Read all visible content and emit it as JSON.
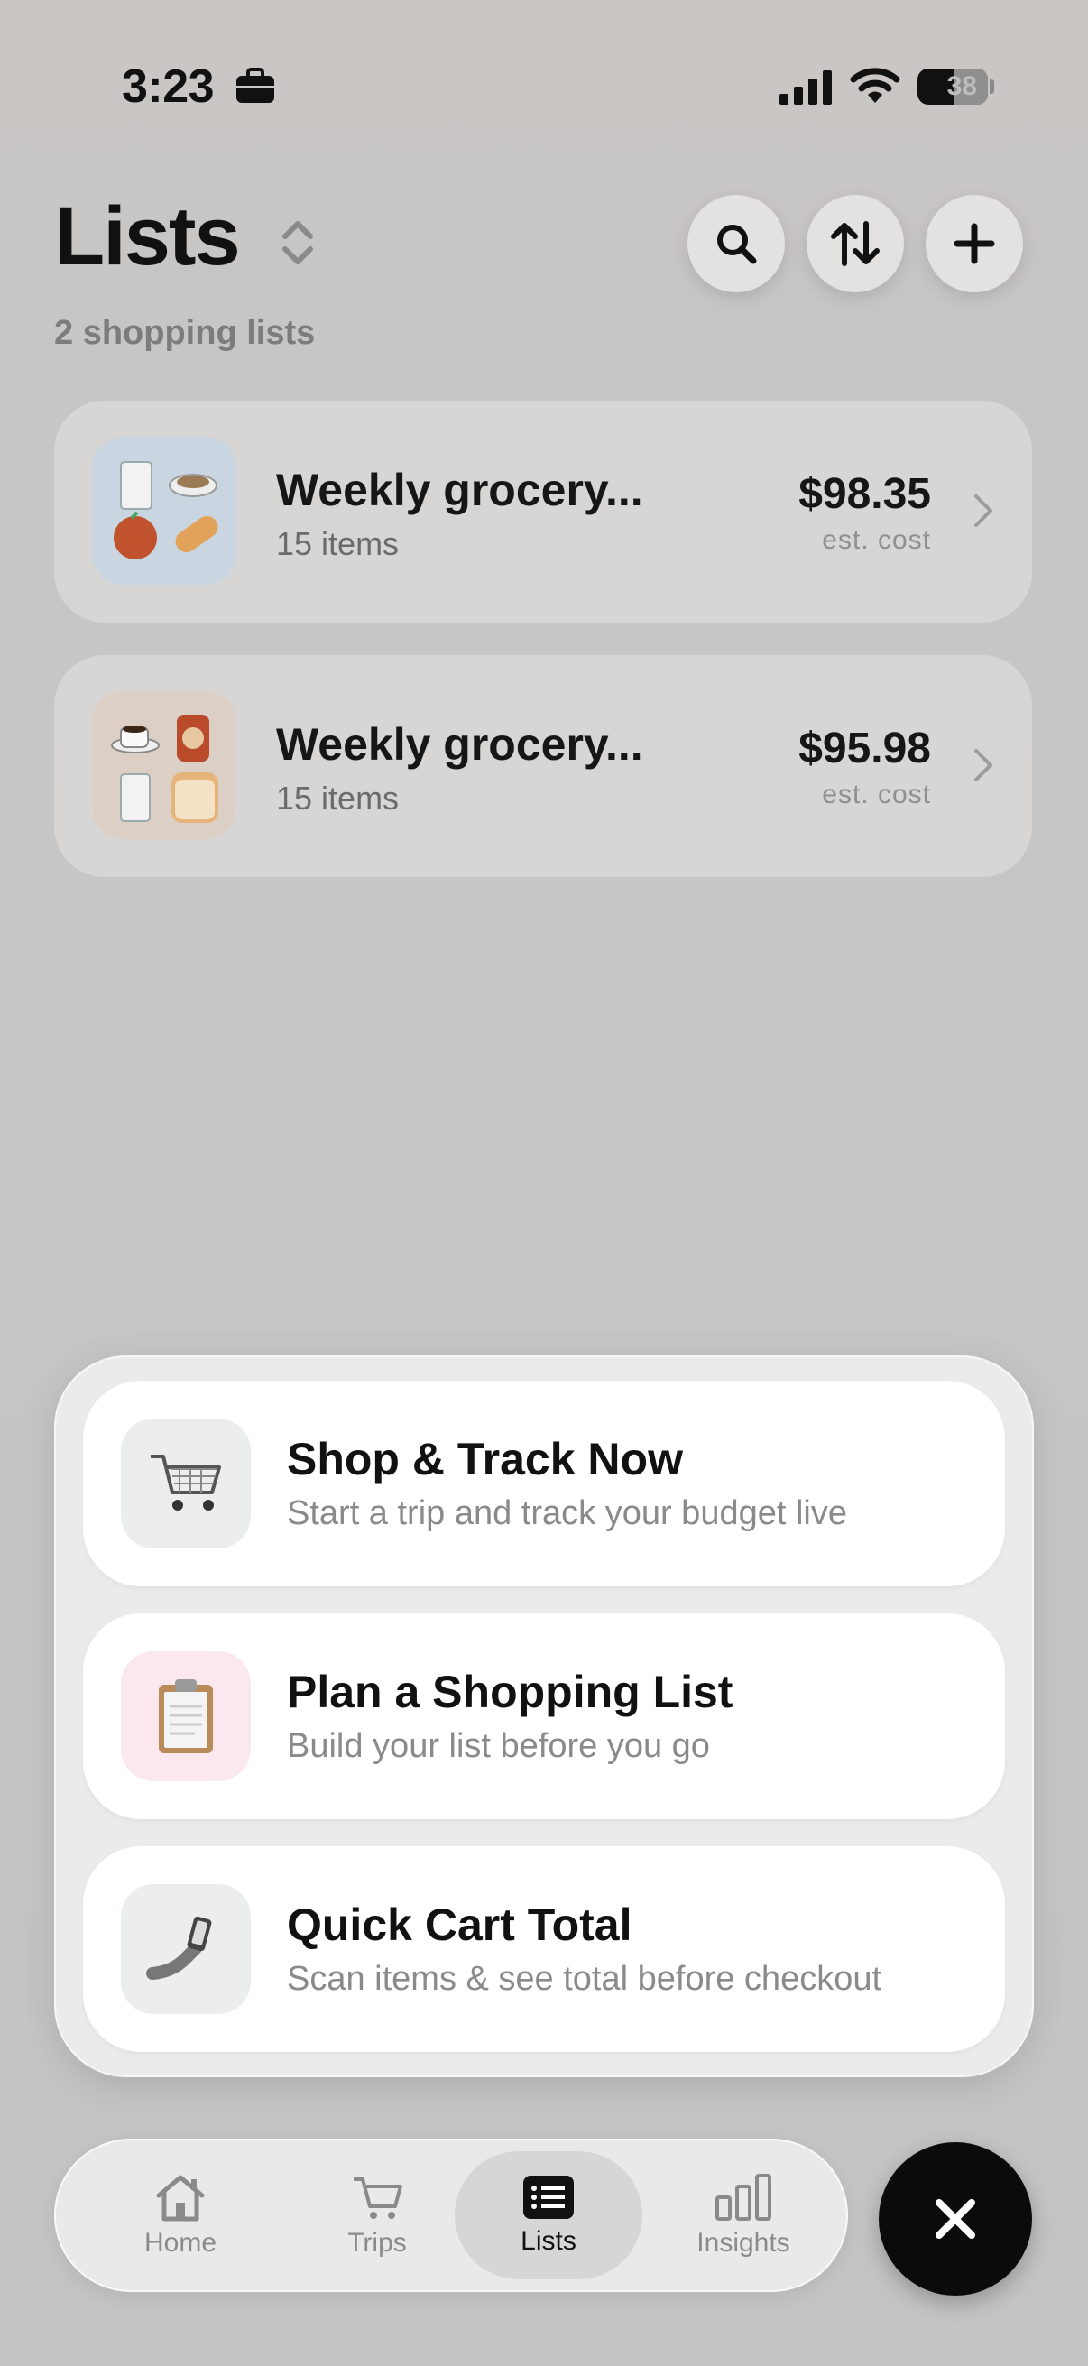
{
  "status_bar": {
    "time": "3:23",
    "battery": "38",
    "icons": [
      "briefcase-icon",
      "cellular-signal-icon",
      "wifi-icon",
      "battery-icon"
    ]
  },
  "header": {
    "title": "Lists",
    "subtitle": "2 shopping lists",
    "buttons": [
      "search-icon",
      "sort-icon",
      "plus-icon"
    ]
  },
  "lists": [
    {
      "title": "Weekly grocery...",
      "count": "15 items",
      "price": "$98.35",
      "price_note": "est. cost",
      "thumb_bg": "#c9d6e2"
    },
    {
      "title": "Weekly grocery...",
      "count": "15 items",
      "price": "$95.98",
      "price_note": "est. cost",
      "thumb_bg": "#dcd0c6"
    }
  ],
  "actions": [
    {
      "title": "Shop & Track Now",
      "subtitle": "Start a trip and track your budget live",
      "icon": "shopping-cart-icon",
      "icon_bg": "#eceeee"
    },
    {
      "title": "Plan a Shopping List",
      "subtitle": "Build your list before you go",
      "icon": "clipboard-icon",
      "icon_bg": "#fbe8ee"
    },
    {
      "title": "Quick Cart Total",
      "subtitle": "Scan items & see total before checkout",
      "icon": "hand-phone-scan-icon",
      "icon_bg": "#eceeee"
    }
  ],
  "tabbar": {
    "tabs": [
      {
        "label": "Home",
        "icon": "home-icon"
      },
      {
        "label": "Trips",
        "icon": "cart-icon"
      },
      {
        "label": "Lists",
        "icon": "list-icon",
        "active": true
      },
      {
        "label": "Insights",
        "icon": "bar-chart-icon"
      }
    ],
    "close_icon": "close-icon"
  }
}
